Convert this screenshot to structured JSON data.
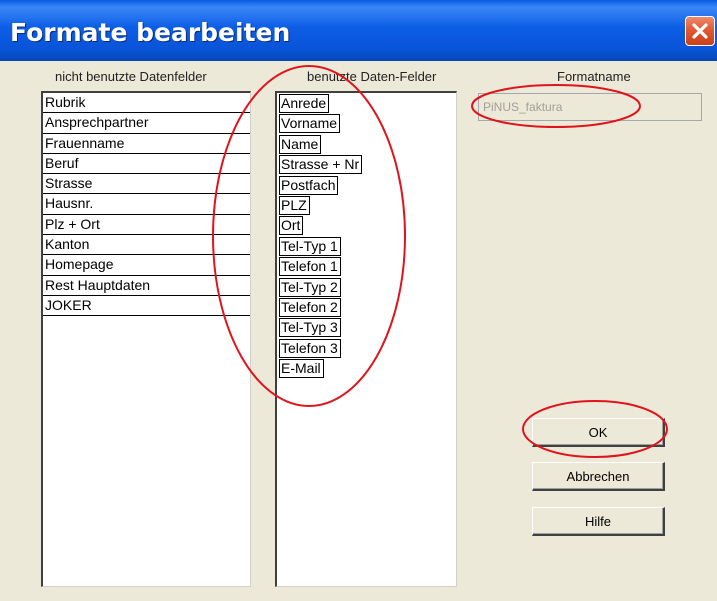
{
  "window": {
    "title": "Formate bearbeiten",
    "close_icon": "close-x-icon"
  },
  "unused_fields": {
    "header": "nicht benutzte Datenfelder",
    "items": [
      "Rubrik",
      "Ansprechpartner",
      "Frauenname",
      "Beruf",
      "Strasse",
      "Hausnr.",
      "Plz + Ort",
      "Kanton",
      "Homepage",
      "Rest Hauptdaten",
      "JOKER"
    ]
  },
  "used_fields": {
    "header": "benutzte Daten-Felder",
    "items": [
      "Anrede",
      "Vorname",
      "Name",
      "Strasse + Nr",
      "Postfach",
      "PLZ",
      "Ort",
      "Tel-Typ 1",
      "Telefon 1",
      "Tel-Typ 2",
      "Telefon 2",
      "Tel-Typ 3",
      "Telefon 3",
      "E-Mail"
    ]
  },
  "format_name": {
    "label": "Formatname",
    "value": "PiNUS_faktura"
  },
  "buttons": {
    "ok": "OK",
    "cancel": "Abbrechen",
    "help": "Hilfe"
  },
  "colors": {
    "titlebar": "#0a5ae6",
    "dialog_bg": "#ece9d8",
    "annotation": "#e0141c"
  }
}
